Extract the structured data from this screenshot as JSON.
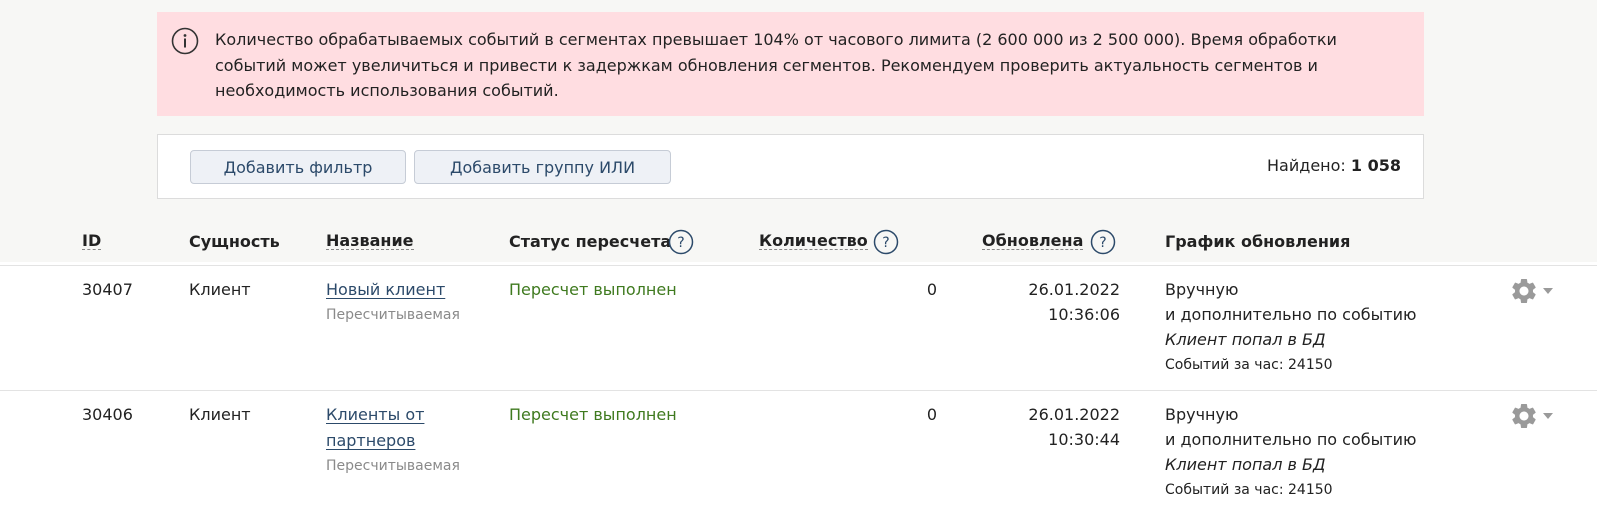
{
  "alert": {
    "text": "Количество обрабатываемых событий в сегментах превышает 104% от часового лимита (2 600 000 из 2 500 000). Время обработки событий может увеличиться и привести к задержкам обновления сегментов. Рекомендуем проверить актуальность сегментов и необходимость использования событий.",
    "icon": "info-icon",
    "background": "#ffdde1"
  },
  "filters": {
    "add_filter_label": "Добавить фильтр",
    "add_or_group_label": "Добавить группу ИЛИ",
    "found_label": "Найдено:",
    "found_count": "1 058"
  },
  "table": {
    "headers": {
      "id": "ID",
      "entity": "Сущность",
      "name": "Название",
      "status": "Статус пересчета",
      "count": "Количество",
      "updated": "Обновлена",
      "schedule": "График обновления"
    },
    "rows": [
      {
        "id": "30407",
        "entity": "Клиент",
        "name_line1": "Новый клиент",
        "name_line2": "",
        "type": "Пересчитываемая",
        "status": "Пересчет выполнен",
        "count": "0",
        "date": "26.01.2022",
        "time": "10:36:06",
        "schedule_mode": "Вручную",
        "schedule_extra": "и дополнительно по событию",
        "schedule_event": "Клиент попал в БД",
        "events_per_hour": "Событий за час: 24150"
      },
      {
        "id": "30406",
        "entity": "Клиент",
        "name_line1": "Клиенты от",
        "name_line2": "партнеров",
        "type": "Пересчитываемая",
        "status": "Пересчет выполнен",
        "count": "0",
        "date": "26.01.2022",
        "time": "10:30:44",
        "schedule_mode": "Вручную",
        "schedule_extra": "и дополнительно по событию",
        "schedule_event": "Клиент попал в БД",
        "events_per_hour": "Событий за час: 24150"
      }
    ]
  },
  "colors": {
    "link": "#2c4a6a",
    "status_ok": "#3f7a1f",
    "muted": "#8a8a8a"
  }
}
